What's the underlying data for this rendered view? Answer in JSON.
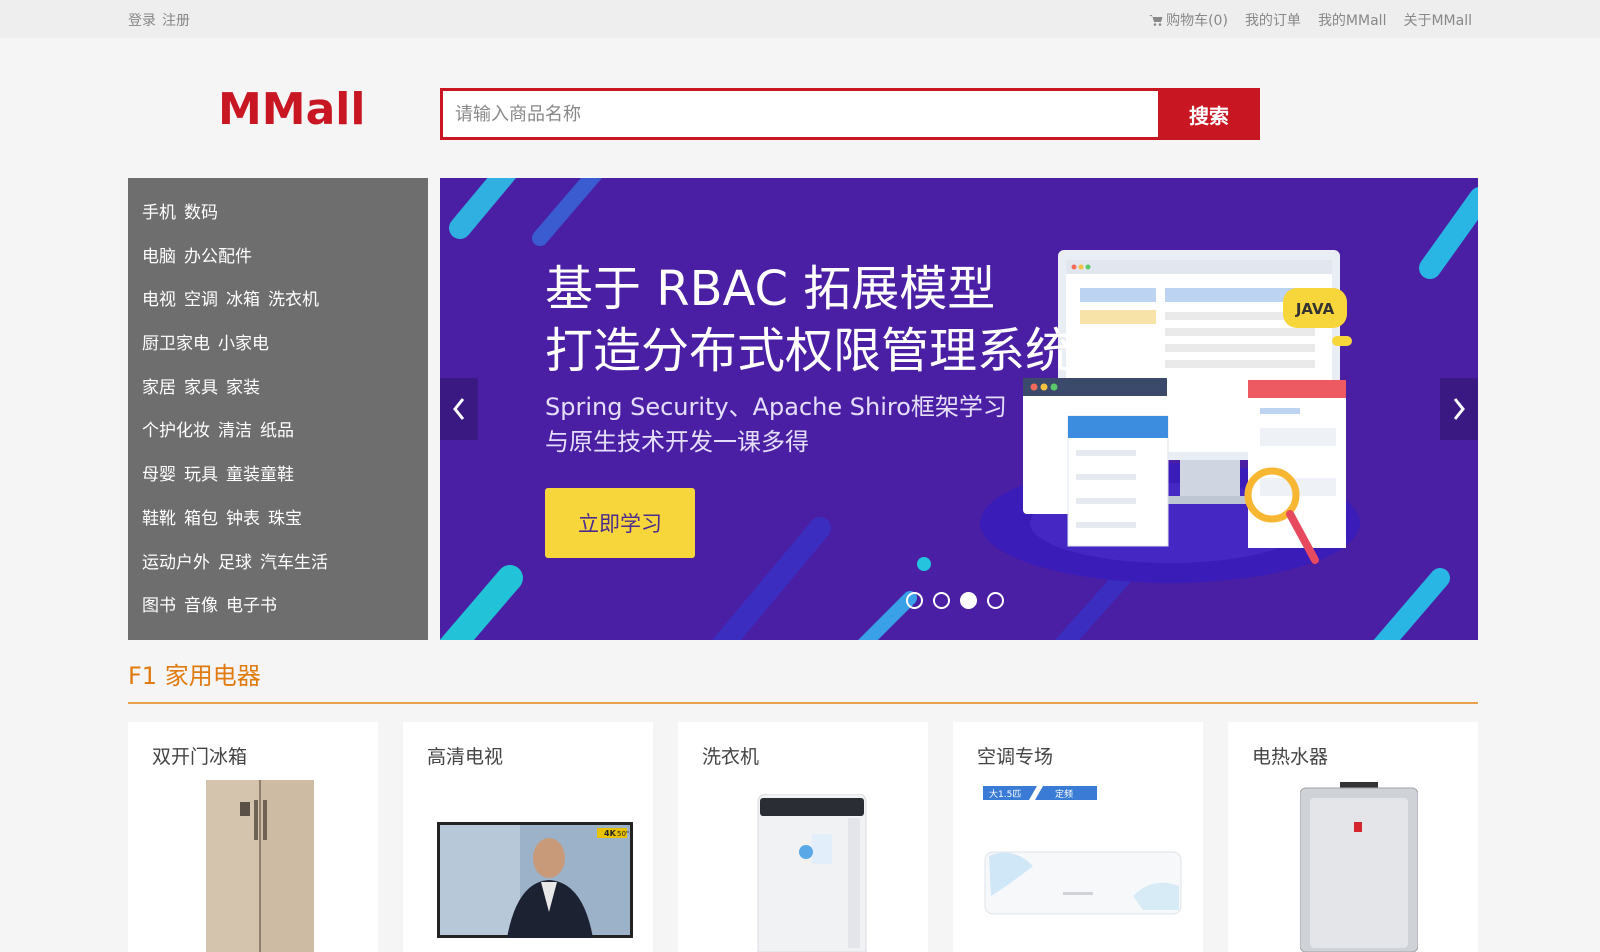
{
  "topbar": {
    "login": "登录",
    "register": "注册",
    "cart": "购物车(0)",
    "orders": "我的订单",
    "my_mmall": "我的MMall",
    "about": "关于MMall"
  },
  "header": {
    "logo": "MMall",
    "search_placeholder": "请输入商品名称",
    "search_button": "搜索"
  },
  "categories": [
    [
      "手机",
      "数码"
    ],
    [
      "电脑",
      "办公配件"
    ],
    [
      "电视",
      "空调",
      "冰箱",
      "洗衣机"
    ],
    [
      "厨卫家电",
      "小家电"
    ],
    [
      "家居",
      "家具",
      "家装"
    ],
    [
      "个护化妆",
      "清洁",
      "纸品"
    ],
    [
      "母婴",
      "玩具",
      "童装童鞋"
    ],
    [
      "鞋靴",
      "箱包",
      "钟表",
      "珠宝"
    ],
    [
      "运动户外",
      "足球",
      "汽车生活"
    ],
    [
      "图书",
      "音像",
      "电子书"
    ]
  ],
  "banner": {
    "title_line1": "基于 RBAC 拓展模型",
    "title_line2": "打造分布式权限管理系统",
    "sub_line1": "Spring Security、Apache Shiro框架学习",
    "sub_line2": "与原生技术开发一课多得",
    "cta": "立即学习",
    "badge": "JAVA",
    "active_slide": 3,
    "slide_count": 4,
    "colors": {
      "bg": "#4a1fa3",
      "accent": "#f7d63b"
    }
  },
  "floor": {
    "title": "F1 家用电器",
    "products": [
      {
        "name": "双开门冰箱",
        "icon": "fridge-image"
      },
      {
        "name": "高清电视",
        "icon": "tv-image"
      },
      {
        "name": "洗衣机",
        "icon": "washer-image"
      },
      {
        "name": "空调专场",
        "icon": "aircon-image",
        "tags": [
          "大1.5匹",
          "定频"
        ]
      },
      {
        "name": "电热水器",
        "icon": "heater-image"
      }
    ]
  },
  "tv_tags": {
    "res": "4K",
    "size": "50\""
  }
}
